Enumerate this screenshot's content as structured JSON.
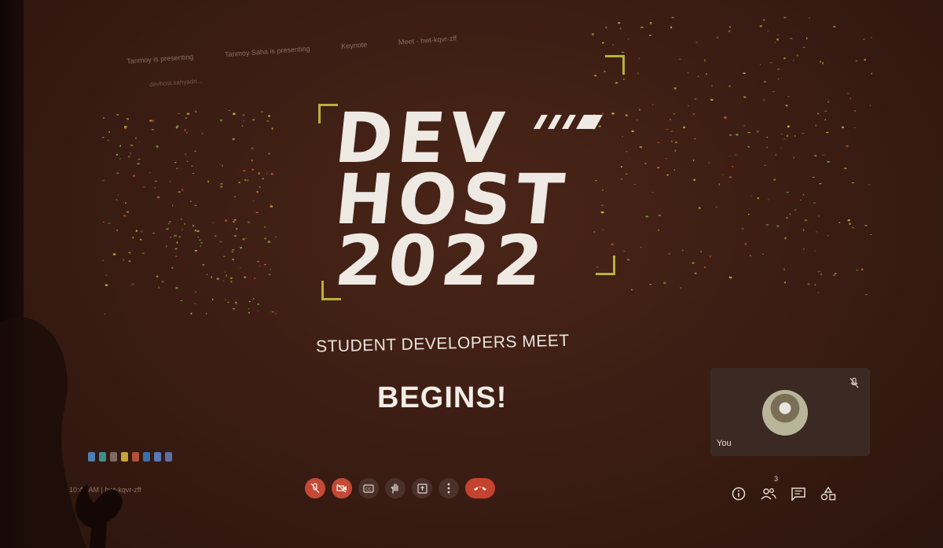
{
  "presenting_notice": "Tanmoy is presenting",
  "browser_tabs": [
    "Tanmoy Saha is presenting",
    "Keynote",
    "Meet - hwt-kqvr-zff"
  ],
  "url_text": "devhost.sahyadri...",
  "event_logo": {
    "lines": [
      "DEV",
      "HOST",
      "2022"
    ],
    "accent_color": "#b9b13a"
  },
  "subtitle": "STUDENT DEVELOPERS MEET",
  "headline": "BEGINS!",
  "self_tile": {
    "label": "You"
  },
  "taskbar": {
    "clock_text": "10:43 AM | hwt-kqvr-zff"
  },
  "meeting_controls": {
    "items": [
      "mic-off",
      "camera-off",
      "captions",
      "raise-hand",
      "present",
      "more-options",
      "end-call"
    ],
    "end_call_color": "#c4432f"
  },
  "side_controls": {
    "participants_count": "3",
    "items": [
      "meeting-details",
      "people",
      "chat",
      "activities"
    ]
  }
}
